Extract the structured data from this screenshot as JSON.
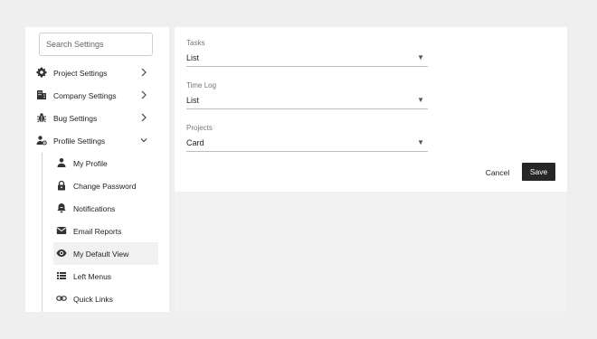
{
  "sidebar": {
    "search_placeholder": "Search Settings",
    "items": [
      {
        "label": "Project Settings",
        "icon": "gear-icon"
      },
      {
        "label": "Company Settings",
        "icon": "building-icon"
      },
      {
        "label": "Bug Settings",
        "icon": "bug-icon"
      },
      {
        "label": "Profile Settings",
        "icon": "user-gear-icon"
      }
    ],
    "sub_items": [
      {
        "label": "My Profile",
        "icon": "person-icon"
      },
      {
        "label": "Change Password",
        "icon": "lock-icon"
      },
      {
        "label": "Notifications",
        "icon": "bell-icon"
      },
      {
        "label": "Email Reports",
        "icon": "envelope-icon"
      },
      {
        "label": "My Default View",
        "icon": "eye-icon",
        "active": true
      },
      {
        "label": "Left Menus",
        "icon": "list-icon"
      },
      {
        "label": "Quick Links",
        "icon": "link-icon"
      }
    ]
  },
  "form": {
    "fields": [
      {
        "label": "Tasks",
        "value": "List"
      },
      {
        "label": "Time Log",
        "value": "List"
      },
      {
        "label": "Projects",
        "value": "Card"
      }
    ],
    "cancel_label": "Cancel",
    "save_label": "Save"
  },
  "colors": {
    "background": "#efefef",
    "panel": "#ffffff",
    "active_item": "#f1f1f1",
    "save_button": "#262626"
  }
}
